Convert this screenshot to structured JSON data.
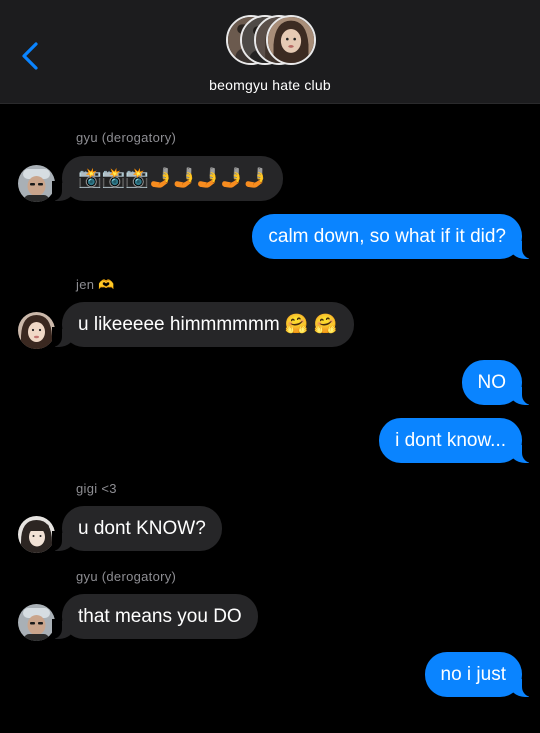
{
  "header": {
    "group_name": "beomgyu hate club",
    "back_icon": "chevron-left-icon",
    "accent_color": "#0a84ff"
  },
  "messages": [
    {
      "sender": "gyu (derogatory)",
      "direction": "incoming",
      "text": "📸📸📸🤳🤳🤳🤳🤳"
    },
    {
      "direction": "outgoing",
      "text": "calm down, so what if it did?"
    },
    {
      "sender": "jen 🫶",
      "direction": "incoming",
      "text": "u likeeeee himmmmmm 🤗 🤗"
    },
    {
      "direction": "outgoing",
      "text": "NO"
    },
    {
      "direction": "outgoing",
      "text": "i dont know..."
    },
    {
      "sender": "gigi <3",
      "direction": "incoming",
      "text": "u dont KNOW?"
    },
    {
      "sender": "gyu (derogatory)",
      "direction": "incoming",
      "text": "that means you DO"
    },
    {
      "direction": "outgoing",
      "text": "no i just"
    }
  ],
  "colors": {
    "incoming_bubble": "#262628",
    "outgoing_bubble": "#0a84ff",
    "background": "#000000",
    "sender_label": "#8e8e93"
  }
}
